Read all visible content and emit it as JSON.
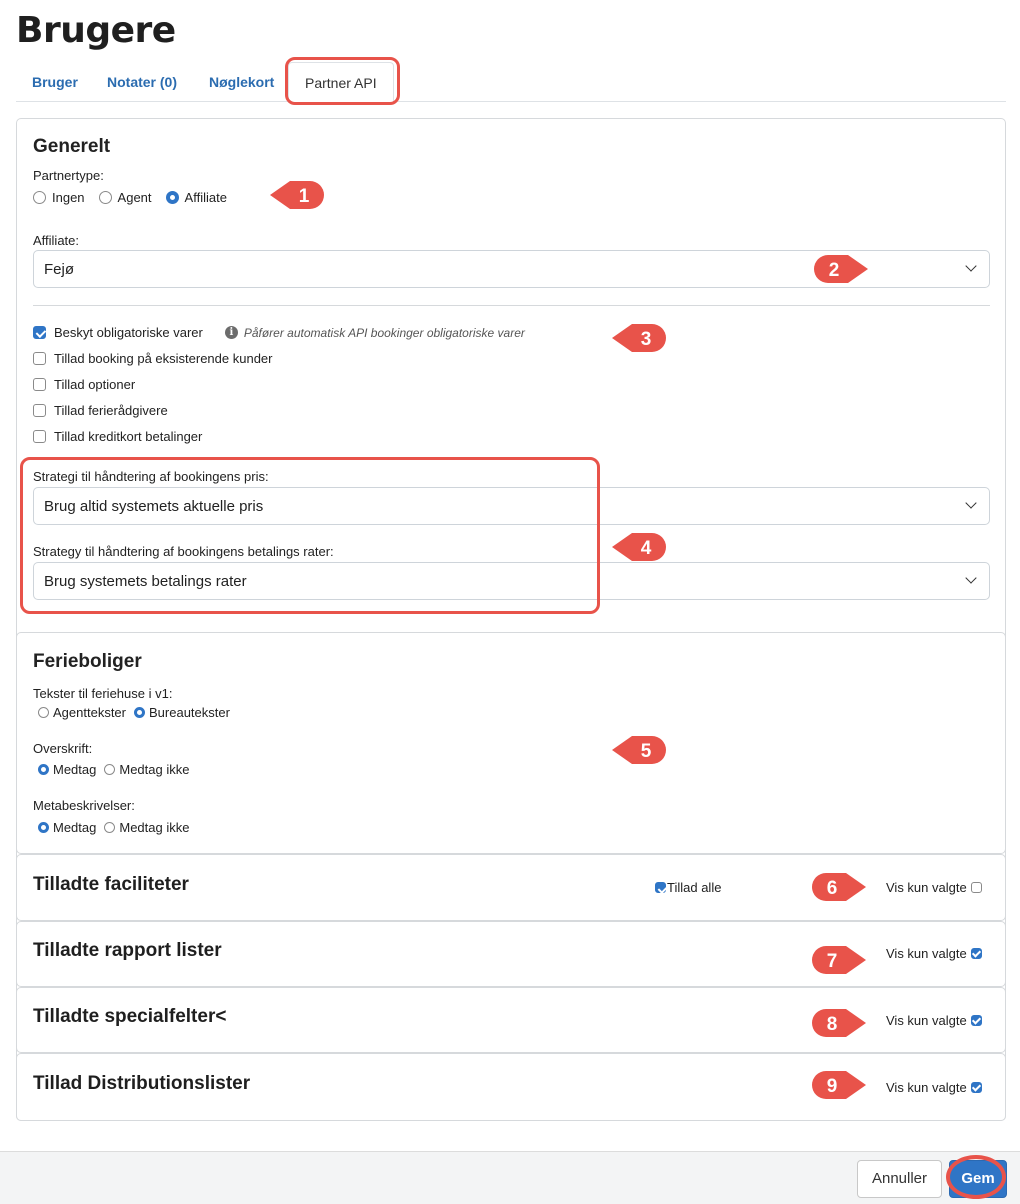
{
  "page": {
    "title": "Brugere"
  },
  "tabs": [
    {
      "label": "Bruger",
      "active": false
    },
    {
      "label": "Notater (0)",
      "active": false
    },
    {
      "label": "Nøglekort",
      "active": false
    },
    {
      "label": "Partner API",
      "active": true
    }
  ],
  "general": {
    "title": "Generelt",
    "partner_type_label": "Partnertype:",
    "partner_type_options": [
      {
        "label": "Ingen",
        "selected": false
      },
      {
        "label": "Agent",
        "selected": false
      },
      {
        "label": "Affiliate",
        "selected": true
      }
    ],
    "affiliate_label": "Affiliate:",
    "affiliate_value": "Fejø",
    "checkboxes": [
      {
        "label": "Beskyt obligatoriske varer",
        "checked": true,
        "hint": "Påfører automatisk API bookinger obligatoriske varer"
      },
      {
        "label": "Tillad booking på eksisterende kunder",
        "checked": false
      },
      {
        "label": "Tillad optioner",
        "checked": false
      },
      {
        "label": "Tillad ferierådgivere",
        "checked": false
      },
      {
        "label": "Tillad kreditkort betalinger",
        "checked": false
      }
    ],
    "price_strategy_label": "Strategi til håndtering af bookingens pris:",
    "price_strategy_value": "Brug altid systemets aktuelle pris",
    "rates_strategy_label": "Strategy til håndtering af bookingens betalings rater:",
    "rates_strategy_value": "Brug systemets betalings rater"
  },
  "holiday_homes": {
    "title": "Ferieboliger",
    "texts_label": "Tekster til feriehuse i v1:",
    "texts_options": [
      {
        "label": "Agenttekster",
        "selected": false
      },
      {
        "label": "Bureautekster",
        "selected": true
      }
    ],
    "headline_label": "Overskrift:",
    "headline_options": [
      {
        "label": "Medtag",
        "selected": true
      },
      {
        "label": "Medtag ikke",
        "selected": false
      }
    ],
    "meta_label": "Metabeskrivelser:",
    "meta_options": [
      {
        "label": "Medtag",
        "selected": true
      },
      {
        "label": "Medtag ikke",
        "selected": false
      }
    ]
  },
  "sections": [
    {
      "title": "Tilladte faciliteter",
      "allow_all_label": "Tillad alle",
      "allow_all_checked": true,
      "show_selected_label": "Vis kun valgte",
      "show_selected_checked": false
    },
    {
      "title": "Tilladte rapport lister",
      "show_selected_label": "Vis kun valgte",
      "show_selected_checked": true
    },
    {
      "title": "Tilladte specialfelter<",
      "show_selected_label": "Vis kun valgte",
      "show_selected_checked": true
    },
    {
      "title": "Tillad Distributionslister",
      "show_selected_label": "Vis kun valgte",
      "show_selected_checked": true
    }
  ],
  "markers": [
    "1",
    "2",
    "3",
    "4",
    "5",
    "6",
    "7",
    "8",
    "9"
  ],
  "footer": {
    "cancel_label": "Annuller",
    "save_label": "Gem"
  },
  "colors": {
    "primary": "#2f75c6",
    "annotation": "#e8534a"
  }
}
